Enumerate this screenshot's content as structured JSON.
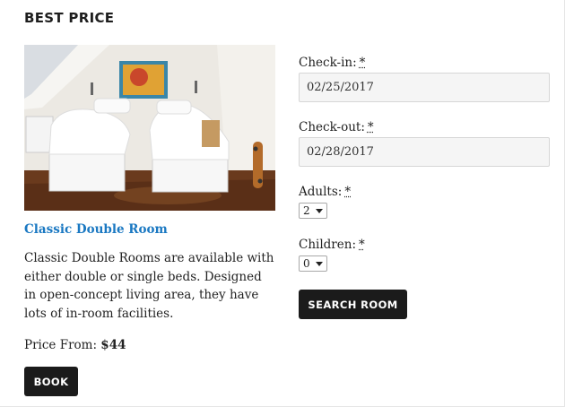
{
  "section": {
    "title": "BEST PRICE"
  },
  "room": {
    "image_alt": "Attic bedroom with two single beds",
    "title": "Classic Double Room",
    "description": "Classic Double Rooms are available with either double or single beds. Designed in open-concept living area, they have lots of in-room facilities.",
    "price_label": "Price From:",
    "price_value": "$44",
    "book_label": "BOOK"
  },
  "form": {
    "checkin_label": "Check-in:",
    "checkin_value": "02/25/2017",
    "checkout_label": "Check-out:",
    "checkout_value": "02/28/2017",
    "adults_label": "Adults:",
    "adults_value": "2",
    "children_label": "Children:",
    "children_value": "0",
    "required_mark": "*",
    "search_label": "SEARCH ROOM"
  },
  "colors": {
    "accent_link": "#1a78c2",
    "button_bg": "#1b1b1b",
    "input_bg": "#f5f5f5"
  }
}
